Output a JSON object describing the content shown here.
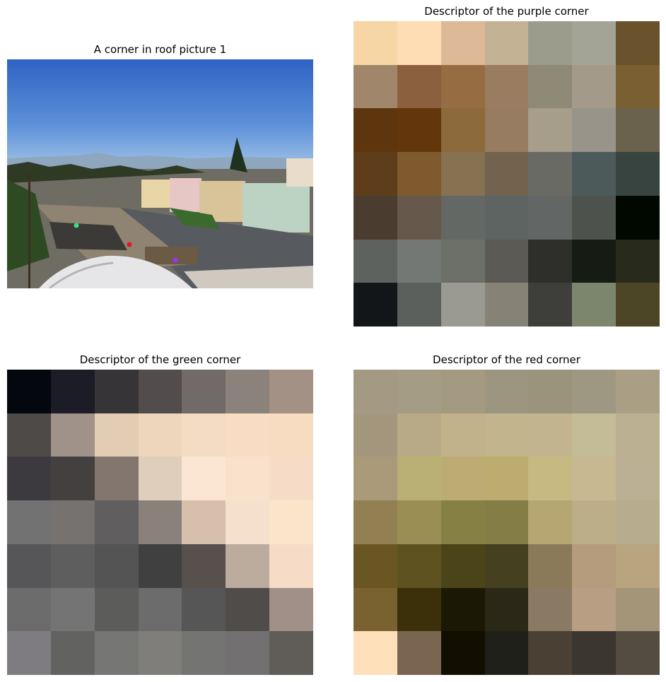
{
  "titles": {
    "photo": "A corner in roof picture 1",
    "purple": "Descriptor of the purple corner",
    "green": "Descriptor of the green corner",
    "red": "Descriptor of the red corner"
  },
  "markers": [
    {
      "name": "green-corner-marker",
      "color": "#3ddc84"
    },
    {
      "name": "red-corner-marker",
      "color": "#e01b1b"
    },
    {
      "name": "purple-corner-marker",
      "color": "#9b30ff"
    }
  ],
  "descriptors": {
    "purple": [
      [
        "#f6d6a5",
        "#fedcb4",
        "#deb998",
        "#c4b295",
        "#9c9c8c",
        "#a4a496",
        "#6a522c"
      ],
      [
        "#a0866a",
        "#8a603e",
        "#966c42",
        "#9a7c60",
        "#8e8a76",
        "#a49a8a",
        "#7a5f32"
      ],
      [
        "#5e360e",
        "#64360c",
        "#8c6a3c",
        "#987c62",
        "#a69e8a",
        "#98948a",
        "#6a624c"
      ],
      [
        "#5e3e1a",
        "#7e5a2e",
        "#867250",
        "#72624e",
        "#6a6a64",
        "#4c5a5a",
        "#384440"
      ],
      [
        "#4a3c2e",
        "#66584a",
        "#646864",
        "#5e6462",
        "#626664",
        "#4e524c",
        "#000800"
      ],
      [
        "#5e625e",
        "#747874",
        "#6c7068",
        "#5c5a54",
        "#2e2e2a",
        "#161c14",
        "#282a1c"
      ],
      [
        "#121618",
        "#5c605c",
        "#9a9a92",
        "#868276",
        "#3e3e3a",
        "#7c866c",
        "#4c4626"
      ]
    ],
    "green": [
      [
        "#04080e",
        "#1c1c26",
        "#363436",
        "#524c4c",
        "#726a68",
        "#8c827c",
        "#a29184"
      ],
      [
        "#4e4a48",
        "#a09288",
        "#e2ccb4",
        "#eed6bc",
        "#f4dcc4",
        "#f8dcc4",
        "#f8dcc2"
      ],
      [
        "#3c3a3e",
        "#444040",
        "#82766e",
        "#e0cebc",
        "#fae6d2",
        "#f8e2cc",
        "#f6dcc6"
      ],
      [
        "#727272",
        "#767270",
        "#605e5e",
        "#8a827a",
        "#d6c0ac",
        "#f4e0cc",
        "#fce4ca"
      ],
      [
        "#565658",
        "#5e5e5e",
        "#545454",
        "#404040",
        "#58504c",
        "#bcac9e",
        "#f6dcc6"
      ],
      [
        "#6c6c6c",
        "#747474",
        "#5c5c5a",
        "#6c6c6c",
        "#565656",
        "#504c4a",
        "#a09088"
      ],
      [
        "#7e7c80",
        "#626260",
        "#767674",
        "#807e7a",
        "#747472",
        "#727070",
        "#605c58"
      ]
    ],
    "red": [
      [
        "#a49a84",
        "#a49c84",
        "#a49a82",
        "#9c9680",
        "#9a947c",
        "#9e9882",
        "#aa9e84"
      ],
      [
        "#a4967c",
        "#b8aa86",
        "#c2b28c",
        "#c2b48c",
        "#c2b48e",
        "#c4bc96",
        "#bcb092"
      ],
      [
        "#aa9a7a",
        "#bab074",
        "#bcac74",
        "#bcac70",
        "#c6ba82",
        "#c8b892",
        "#bcb094"
      ],
      [
        "#928052",
        "#9a8e54",
        "#868044",
        "#847e46",
        "#b6a672",
        "#bcae88",
        "#b8ac8e"
      ],
      [
        "#6a5622",
        "#5e5220",
        "#4a4418",
        "#444020",
        "#8a7a5a",
        "#b49c7c",
        "#b8a47e"
      ],
      [
        "#7a6230",
        "#3c300a",
        "#1c1806",
        "#2c2818",
        "#8a7a64",
        "#b89e82",
        "#a49478"
      ],
      [
        "#fee0ba",
        "#7a6650",
        "#120e02",
        "#20201a",
        "#4a4034",
        "#3c3630",
        "#544c40"
      ]
    ]
  }
}
